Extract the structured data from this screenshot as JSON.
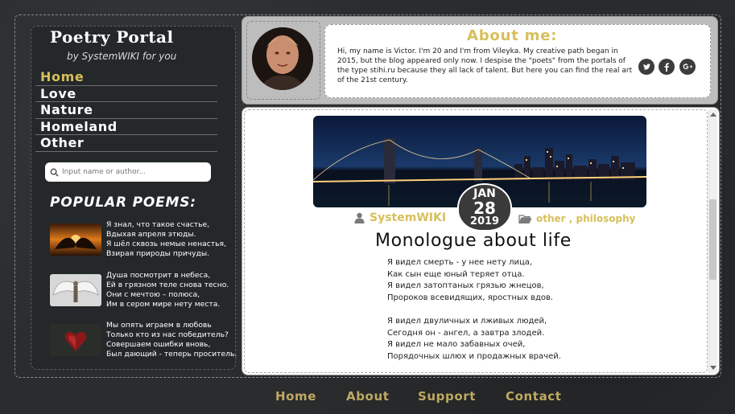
{
  "brand": {
    "title": "Poetry Portal",
    "subtitle": "by SystemWIKI for you"
  },
  "nav": {
    "items": [
      {
        "label": "Home",
        "active": true
      },
      {
        "label": "Love",
        "active": false
      },
      {
        "label": "Nature",
        "active": false
      },
      {
        "label": "Homeland",
        "active": false
      },
      {
        "label": "Other",
        "active": false
      }
    ]
  },
  "search": {
    "placeholder": "Input name or author..."
  },
  "popular": {
    "title": "POPULAR POEMS:",
    "poems": [
      {
        "lines": [
          "Я знал, что такое счастье,",
          "Вдыхая апреля этюды.",
          "Я шёл сквозь немые ненастья,",
          "Взирая природы причуды."
        ]
      },
      {
        "lines": [
          "Душа посмотрит в небеса,",
          "Ей в грязном теле снова тесно.",
          "Они с мечтою – полюса,",
          "Им в сером мире нету места."
        ]
      },
      {
        "lines": [
          "Мы опять играем в любовь",
          "Только кто из нас победитель?",
          "Совершаем ошибки вновь,",
          "Был дающий - теперь проситель."
        ]
      }
    ]
  },
  "about": {
    "title": "About me:",
    "text": "Hi, my name is Victor. I'm 20 and I'm from Vileyka. My creative path began in 2015, but the blog appeared only now. I despise the \"poets\" from the portals of the type stihi.ru because they all lack of talent. But here you can find the real art of the 21st century.",
    "social": [
      "twitter-icon",
      "facebook-icon",
      "google-plus-icon"
    ]
  },
  "post": {
    "date": {
      "month": "JAN",
      "day": "28",
      "year": "2019"
    },
    "author": "SystemWIKI",
    "tags": "other , philosophy",
    "title": "Monologue about life",
    "stanzas": [
      [
        "Я видел смерть - у нее нету лица,",
        "Как сын еще юный теряет отца.",
        "Я видел затоптаных грязью жнецов,",
        "Пророков всевидящих, яростных вдов."
      ],
      [
        "Я видел двуличных и лживых людей,",
        "Сегодня он - ангел, а завтра злодей.",
        "Я видел не мало забавных очей,",
        "Порядочных шлюх и продажных врачей."
      ]
    ]
  },
  "footer": {
    "links": [
      "Home",
      "About",
      "Support",
      "Contact"
    ]
  },
  "colors": {
    "accent": "#d7bf5a",
    "sidebar": "#24282a",
    "footer_link": "#bfa962"
  }
}
